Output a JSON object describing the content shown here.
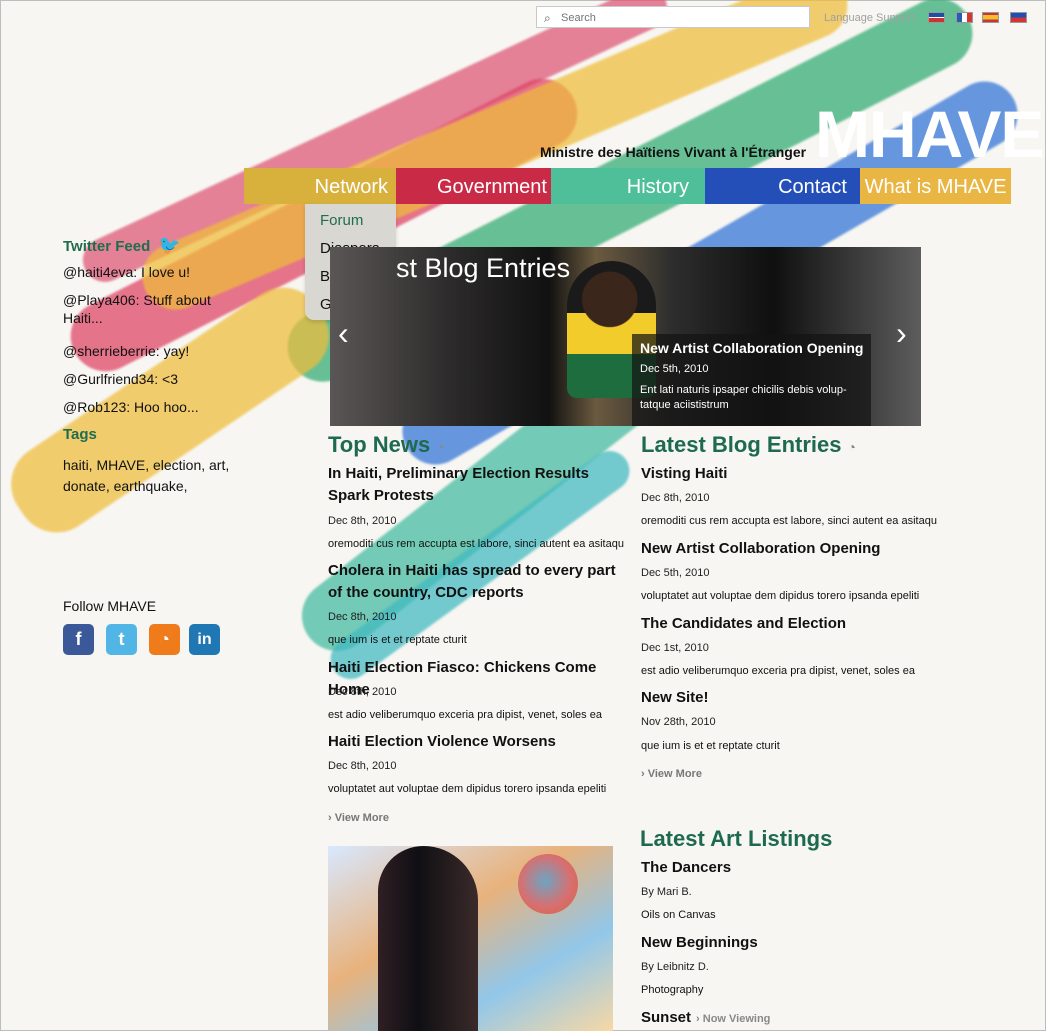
{
  "header": {
    "search_placeholder": "Search",
    "language_label": "Language Support",
    "flags": [
      "us-flag-icon",
      "fr-flag-icon",
      "es-flag-icon",
      "ht-flag-icon"
    ],
    "logo": "MHAVE",
    "tagline": "Ministre des Haïtiens Vivant à l'Étranger"
  },
  "nav": {
    "items": [
      "Network",
      "Government",
      "History",
      "Contact",
      "What is MHAVE"
    ],
    "dropdown": [
      "Forum",
      "Diaspora",
      "Blog",
      "Gallery"
    ]
  },
  "sidebar": {
    "twitter_title": "Twitter Feed",
    "tweets": [
      "@haiti4eva: I love u!",
      "@Playa406: Stuff about Haiti...",
      "@sherrieberrie: yay!",
      "@Gurlfriend34: <3",
      "@Rob123: Hoo hoo..."
    ],
    "tags_title": "Tags",
    "tags_text": "haiti, MHAVE, election, art, donate, earthquake,",
    "follow_title": "Follow MHAVE",
    "social": [
      "facebook-icon",
      "twitter-icon",
      "rss-icon",
      "linkedin-icon"
    ]
  },
  "hero": {
    "title": "st Blog Entries",
    "caption_title": "New Artist Collaboration Opening",
    "caption_date": "Dec 5th, 2010",
    "caption_text": "Ent lati naturis ipsaper chicilis debis volup-tatque aciististrum"
  },
  "top_news": {
    "title": "Top News",
    "items": [
      {
        "title": "In Haiti, Preliminary Election Results Spark Protests",
        "date": "Dec 8th, 2010",
        "excerpt": "oremoditi cus rem accupta est labore, sinci autent ea asitaqu"
      },
      {
        "title": "Cholera in Haiti has spread to every part of the country, CDC reports",
        "date": "Dec 8th, 2010",
        "excerpt": "que ium is et et reptate cturit"
      },
      {
        "title": "Haiti Election Fiasco: Chickens Come Home",
        "date": "Dec 8th, 2010",
        "excerpt": "est adio veliberumquo exceria pra dipist, venet, soles ea"
      },
      {
        "title": "Haiti Election Violence Worsens",
        "date": "Dec 8th, 2010",
        "excerpt": "voluptatet aut voluptae dem dipidus torero ipsanda epeliti"
      }
    ],
    "more": "View More"
  },
  "blog": {
    "title": "Latest Blog Entries",
    "items": [
      {
        "title": "Visting Haiti",
        "date": "Dec 8th, 2010",
        "excerpt": "oremoditi cus rem accupta est labore, sinci autent ea asitaqu"
      },
      {
        "title": "New Artist Collaboration Opening",
        "date": "Dec 5th, 2010",
        "excerpt": "voluptatet aut voluptae dem dipidus torero ipsanda epeliti"
      },
      {
        "title": "The Candidates and Election",
        "date": "Dec 1st, 2010",
        "excerpt": "est adio veliberumquo exceria pra dipist, venet, soles ea"
      },
      {
        "title": "New Site!",
        "date": "Nov 28th, 2010",
        "excerpt": "que ium is et et reptate cturit"
      }
    ],
    "more": "View More"
  },
  "art": {
    "title": "Latest Art Listings",
    "items": [
      {
        "title": "The Dancers",
        "artist": "By Mari B.",
        "medium": "Oils on Canvas"
      },
      {
        "title": "New Beginnings",
        "artist": "By Leibnitz D.",
        "medium": "Photography"
      },
      {
        "title": "Sunset",
        "status": "Now Viewing"
      }
    ]
  }
}
